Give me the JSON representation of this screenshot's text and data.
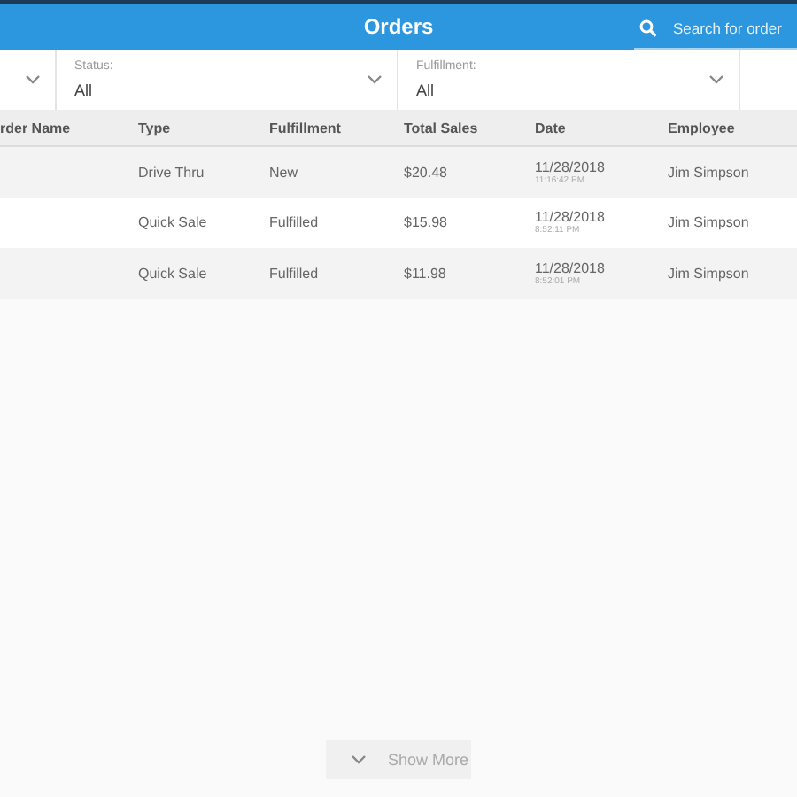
{
  "header": {
    "title": "Orders",
    "search": {
      "placeholder": "Search for order"
    }
  },
  "filters": [
    {
      "kind": "clipped"
    },
    {
      "kind": "full",
      "label": "Status:",
      "value": "All"
    },
    {
      "kind": "full",
      "label": "Fulfillment:",
      "value": "All"
    }
  ],
  "table": {
    "columns": [
      "rder Name",
      "Type",
      "Fulfillment",
      "Total Sales",
      "Date",
      "Employee"
    ],
    "rows": [
      {
        "type": "Drive Thru",
        "fulfillment": "New",
        "total": "$20.48",
        "date": "11/28/2018",
        "time": "11:16:42 PM",
        "employee": "Jim Simpson"
      },
      {
        "type": "Quick Sale",
        "fulfillment": "Fulfilled",
        "total": "$15.98",
        "date": "11/28/2018",
        "time": "8:52:11 PM",
        "employee": "Jim Simpson"
      },
      {
        "type": "Quick Sale",
        "fulfillment": "Fulfilled",
        "total": "$11.98",
        "date": "11/28/2018",
        "time": "8:52:01 PM",
        "employee": "Jim Simpson"
      }
    ]
  },
  "show_more": "Show More"
}
